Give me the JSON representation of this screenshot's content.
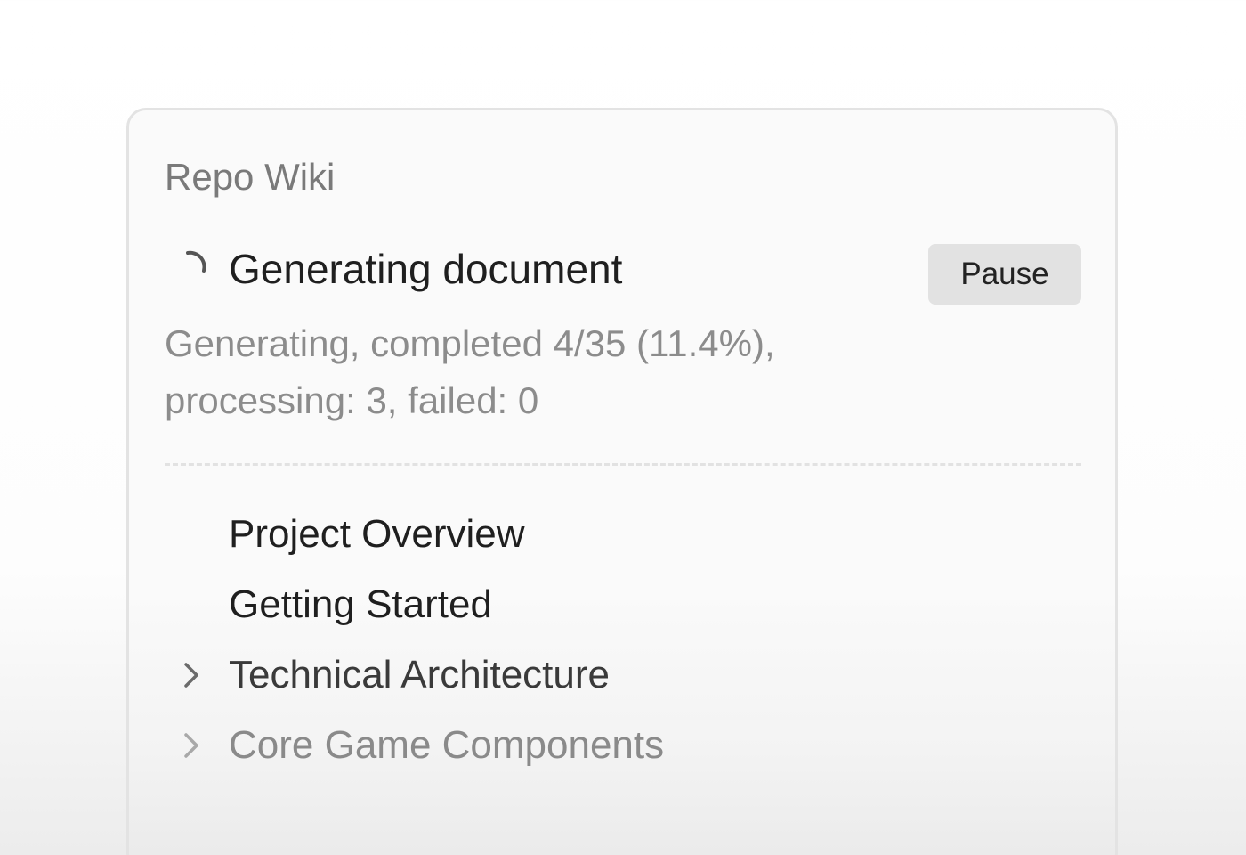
{
  "panel": {
    "title": "Repo Wiki"
  },
  "status": {
    "icon": "loading-spinner-icon",
    "title": "Generating document",
    "pause_label": "Pause",
    "progress_line1": "Generating, completed 4/35 (11.4%),",
    "progress_line2": "processing: 3, failed: 0"
  },
  "tree": {
    "items": [
      {
        "label": "Project Overview",
        "has_children": false,
        "color": "#1f1f1f"
      },
      {
        "label": "Getting Started",
        "has_children": false,
        "color": "#1f1f1f"
      },
      {
        "label": "Technical Architecture",
        "has_children": true,
        "icon": "chevron-right-icon",
        "color": "#3a3a3a"
      },
      {
        "label": "Core Game Components",
        "has_children": true,
        "icon": "chevron-right-icon",
        "color": "#8a8a8a"
      }
    ]
  },
  "colors": {
    "text_primary": "#1f1f1f",
    "text_muted": "#8c8c8c",
    "button_bg": "#e2e2e2",
    "border": "#e3e3e3"
  }
}
